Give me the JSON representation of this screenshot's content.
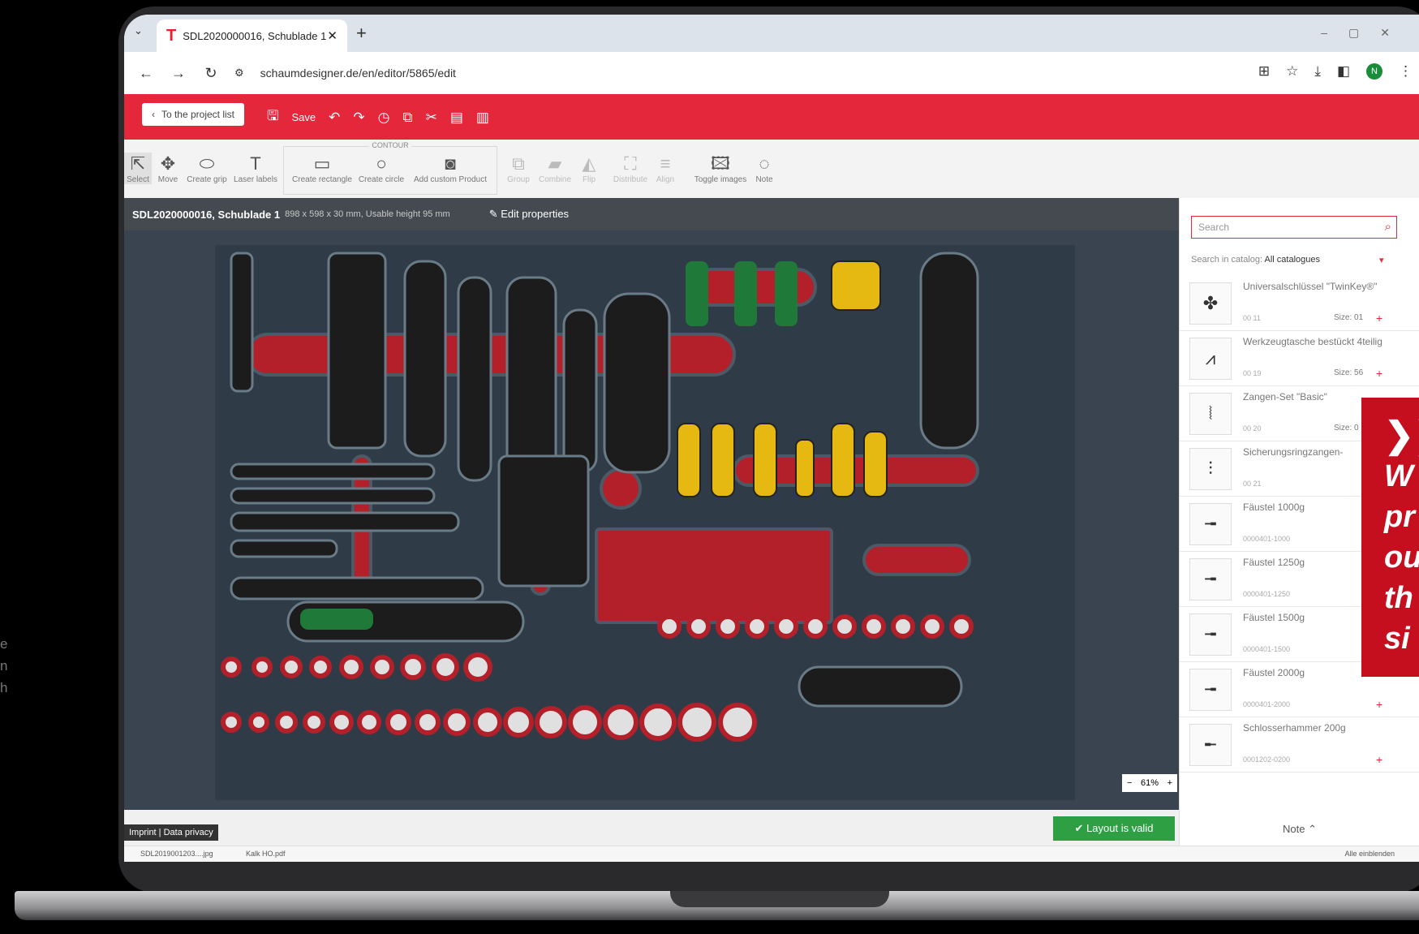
{
  "side_text": [
    "e",
    "n",
    "h"
  ],
  "browser": {
    "tab_title": "SDL2020000016, Schublade 1",
    "url": "schaumdesigner.de/en/editor/5865/edit",
    "avatar_letter": "N"
  },
  "appbar": {
    "back_label": "To the project list",
    "save_label": "Save"
  },
  "toolbar": {
    "contour_group": "CONTOUR",
    "tools": [
      "Select",
      "Move",
      "Create grip",
      "Laser labels",
      "Create rectangle",
      "Create circle",
      "Add custom Product",
      "Group",
      "Combine",
      "Flip",
      "Distribute",
      "Align",
      "Toggle images",
      "Note"
    ]
  },
  "drawer": {
    "title": "SDL2020000016, Schublade 1",
    "dimensions": "898 x 598 x 30 mm, Usable height 95 mm",
    "edit_label": "Edit properties"
  },
  "canvas": {
    "zoom_minus": "−",
    "zoom_value": "61%",
    "zoom_plus": "+"
  },
  "footer": {
    "imprint": "Imprint",
    "privacy": "Data privacy",
    "valid": "Layout is valid"
  },
  "sidebar": {
    "search_placeholder": "Search",
    "catalog_label": "Search in catalog:",
    "catalog_value": "All catalogues",
    "items": [
      {
        "name": "Universalschlüssel \"TwinKey®\"",
        "code": "00 11",
        "size": "Size: 01"
      },
      {
        "name": "Werkzeugtasche bestückt 4teilig",
        "code": "00 19",
        "size": "Size: 56"
      },
      {
        "name": "Zangen-Set \"Basic\"",
        "code": "00 20",
        "size": "Size: 0"
      },
      {
        "name": "Sicherungsringzangen-",
        "code": "00 21",
        "size": ""
      },
      {
        "name": "Fäustel 1000g",
        "code": "0000401-1000",
        "size": ""
      },
      {
        "name": "Fäustel 1250g",
        "code": "0000401-1250",
        "size": ""
      },
      {
        "name": "Fäustel 1500g",
        "code": "0000401-1500",
        "size": ""
      },
      {
        "name": "Fäustel 2000g",
        "code": "0000401-2000",
        "size": ""
      },
      {
        "name": "Schlosserhammer 200g",
        "code": "0001202-0200",
        "size": ""
      }
    ],
    "note_label": "Note"
  },
  "downloads": {
    "file1": "SDL2019001203....jpg",
    "file2": "Kalk HO.pdf",
    "show_all": "Alle einblenden"
  },
  "promo": {
    "line1": "W",
    "line2": "pr",
    "line3": "ou",
    "line4": "th",
    "line5": "si"
  }
}
